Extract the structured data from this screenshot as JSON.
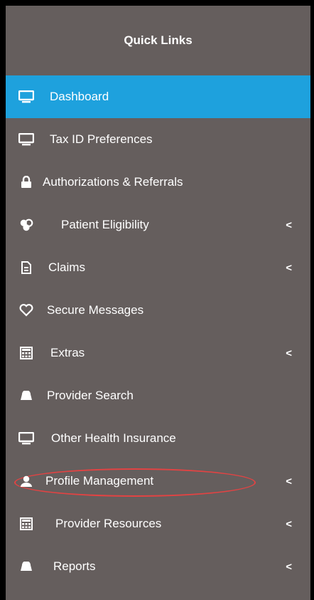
{
  "quick_links": {
    "title": "Quick Links",
    "items": [
      {
        "label": "Dashboard",
        "icon": "monitor-icon",
        "active": true,
        "has_submenu": false
      },
      {
        "label": "Tax ID Preferences",
        "icon": "monitor-icon",
        "active": false,
        "has_submenu": false
      },
      {
        "label": "Authorizations & Referrals",
        "icon": "lock-icon",
        "active": false,
        "has_submenu": false
      },
      {
        "label": "Patient Eligibility",
        "icon": "group-icon",
        "active": false,
        "has_submenu": true
      },
      {
        "label": "Claims",
        "icon": "document-icon",
        "active": false,
        "has_submenu": true
      },
      {
        "label": "Secure Messages",
        "icon": "heart-icon",
        "active": false,
        "has_submenu": false
      },
      {
        "label": "Extras",
        "icon": "calculator-icon",
        "active": false,
        "has_submenu": true
      },
      {
        "label": "Provider Search",
        "icon": "cloud-icon",
        "active": false,
        "has_submenu": false
      },
      {
        "label": "Other Health Insurance",
        "icon": "monitor-icon",
        "active": false,
        "has_submenu": false
      },
      {
        "label": "Profile Management",
        "icon": "user-icon",
        "active": false,
        "has_submenu": true,
        "highlighted": true
      },
      {
        "label": "Provider Resources",
        "icon": "calculator-icon",
        "active": false,
        "has_submenu": true
      },
      {
        "label": "Reports",
        "icon": "cloud-icon",
        "active": false,
        "has_submenu": true
      }
    ],
    "chevron": "<"
  },
  "colors": {
    "panel_bg": "#655e5d",
    "active_bg": "#1ea1dd",
    "highlight_circle": "#e24343",
    "text": "#ffffff"
  }
}
